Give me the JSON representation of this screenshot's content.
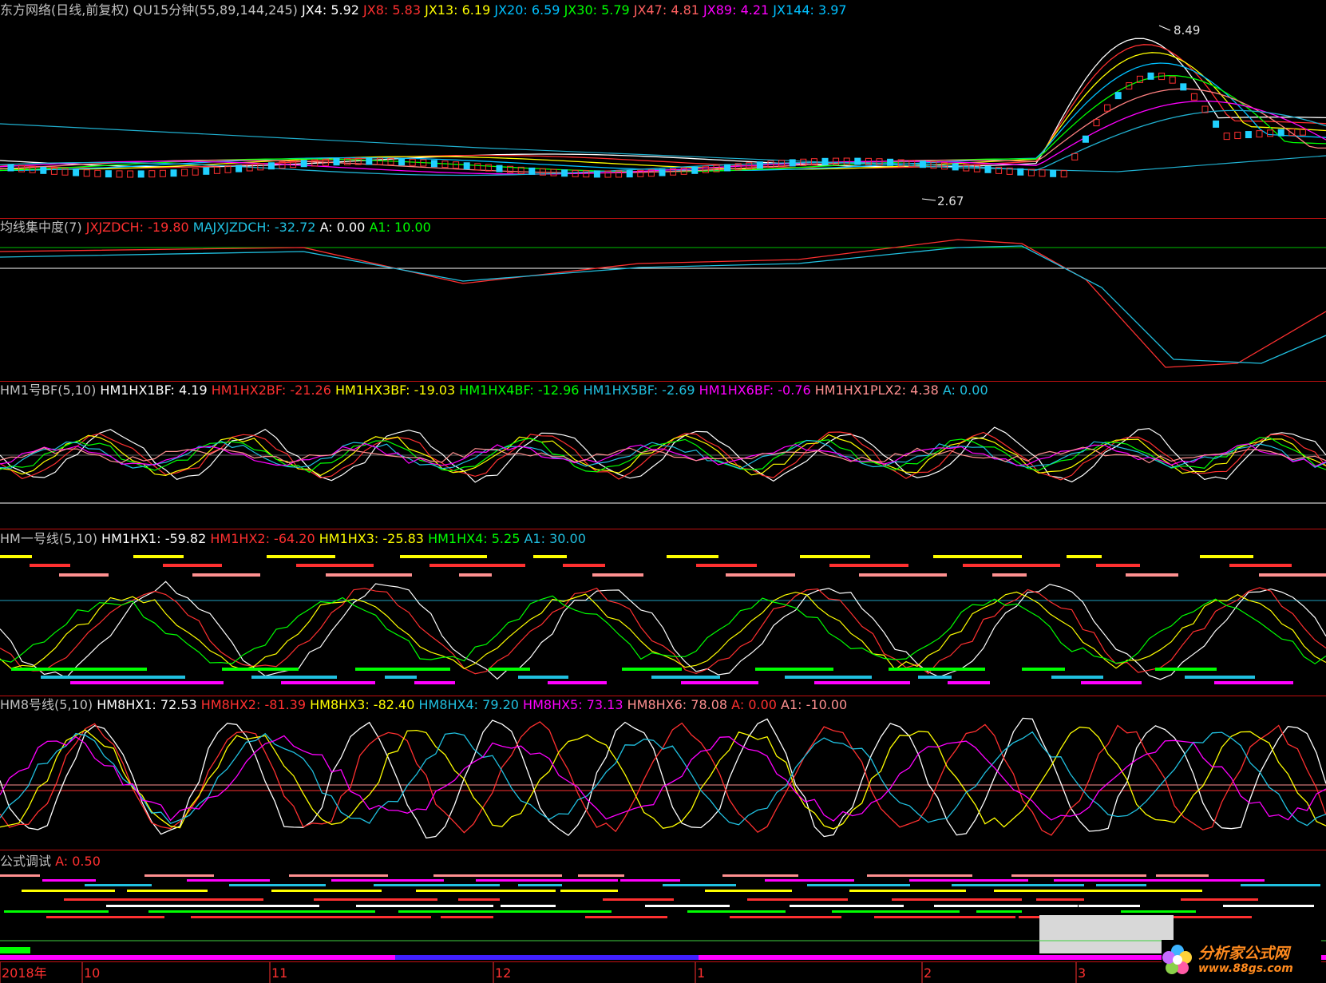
{
  "chart_data": [
    {
      "type": "line",
      "panel": "main",
      "legend": [
        {
          "text": "东方网络(日线,前复权)",
          "color": "#c0c0c0"
        },
        {
          "text": "QU15分钟(55,89,144,245)",
          "color": "#c0c0c0"
        },
        {
          "text": "JX4: 5.92",
          "color": "#ffffff"
        },
        {
          "text": "JX8: 5.83",
          "color": "#ff3030"
        },
        {
          "text": "JX13: 6.19",
          "color": "#ffff00"
        },
        {
          "text": "JX20: 6.59",
          "color": "#00c0ff"
        },
        {
          "text": "JX30: 5.79",
          "color": "#00ff00"
        },
        {
          "text": "JX47: 4.81",
          "color": "#ff6060"
        },
        {
          "text": "JX89: 4.21",
          "color": "#ff00ff"
        },
        {
          "text": "JX144: 3.97",
          "color": "#00c0ff"
        }
      ],
      "annotations": [
        {
          "text": "8.49",
          "role": "high"
        },
        {
          "text": "2.67",
          "role": "low"
        }
      ],
      "series_colors": [
        "#ffffff",
        "#ff3030",
        "#ffff00",
        "#00c0ff",
        "#00ff00",
        "#ff8080",
        "#ff00ff",
        "#20b0d0"
      ]
    },
    {
      "type": "line",
      "panel": "jxjzd",
      "legend": [
        {
          "text": "均线集中度(7)",
          "color": "#c0c0c0"
        },
        {
          "text": "JXJZDCH: -19.80",
          "color": "#ff3030"
        },
        {
          "text": "MAJXJZDCH: -32.72",
          "color": "#20c0e0"
        },
        {
          "text": "A: 0.00",
          "color": "#ffffff"
        },
        {
          "text": "A1: 10.00",
          "color": "#00ff00"
        }
      ]
    },
    {
      "type": "line",
      "panel": "hm1bf",
      "legend": [
        {
          "text": "HM1号BF(5,10)",
          "color": "#c0c0c0"
        },
        {
          "text": "HM1HX1BF: 4.19",
          "color": "#ffffff"
        },
        {
          "text": "HM1HX2BF: -21.26",
          "color": "#ff3030"
        },
        {
          "text": "HM1HX3BF: -19.03",
          "color": "#ffff00"
        },
        {
          "text": "HM1HX4BF: -12.96",
          "color": "#00ff00"
        },
        {
          "text": "HM1HX5BF: -2.69",
          "color": "#20c0e0"
        },
        {
          "text": "HM1HX6BF: -0.76",
          "color": "#ff00ff"
        },
        {
          "text": "HM1HX1PLX2: 4.38",
          "color": "#ff9090"
        },
        {
          "text": "A: 0.00",
          "color": "#20c0e0"
        }
      ]
    },
    {
      "type": "line",
      "panel": "hm1",
      "legend": [
        {
          "text": "HM一号线(5,10)",
          "color": "#c0c0c0"
        },
        {
          "text": "HM1HX1: -59.82",
          "color": "#ffffff"
        },
        {
          "text": "HM1HX2: -64.20",
          "color": "#ff3030"
        },
        {
          "text": "HM1HX3: -25.83",
          "color": "#ffff00"
        },
        {
          "text": "HM1HX4: 5.25",
          "color": "#00ff00"
        },
        {
          "text": "A1: 30.00",
          "color": "#20c0e0"
        }
      ]
    },
    {
      "type": "line",
      "panel": "hm8",
      "legend": [
        {
          "text": "HM8号线(5,10)",
          "color": "#c0c0c0"
        },
        {
          "text": "HM8HX1: 72.53",
          "color": "#ffffff"
        },
        {
          "text": "HM8HX2: -81.39",
          "color": "#ff3030"
        },
        {
          "text": "HM8HX3: -82.40",
          "color": "#ffff00"
        },
        {
          "text": "HM8HX4: 79.20",
          "color": "#20c0e0"
        },
        {
          "text": "HM8HX5: 73.13",
          "color": "#ff00ff"
        },
        {
          "text": "HM8HX6: 78.08",
          "color": "#ff9090"
        },
        {
          "text": "A: 0.00",
          "color": "#ff3030"
        },
        {
          "text": "A1: -10.00",
          "color": "#ff9090"
        }
      ]
    },
    {
      "type": "bar",
      "panel": "debug",
      "legend": [
        {
          "text": "公式调试",
          "color": "#c0c0c0"
        },
        {
          "text": "A: 0.50",
          "color": "#ff3030"
        }
      ]
    }
  ],
  "x_axis": {
    "labels": [
      "2018年",
      "10",
      "11",
      "12",
      "1",
      "2",
      "3"
    ],
    "color": "#ff3030"
  },
  "watermark": {
    "title": "分析家公式网",
    "url": "www.88gs.com"
  }
}
